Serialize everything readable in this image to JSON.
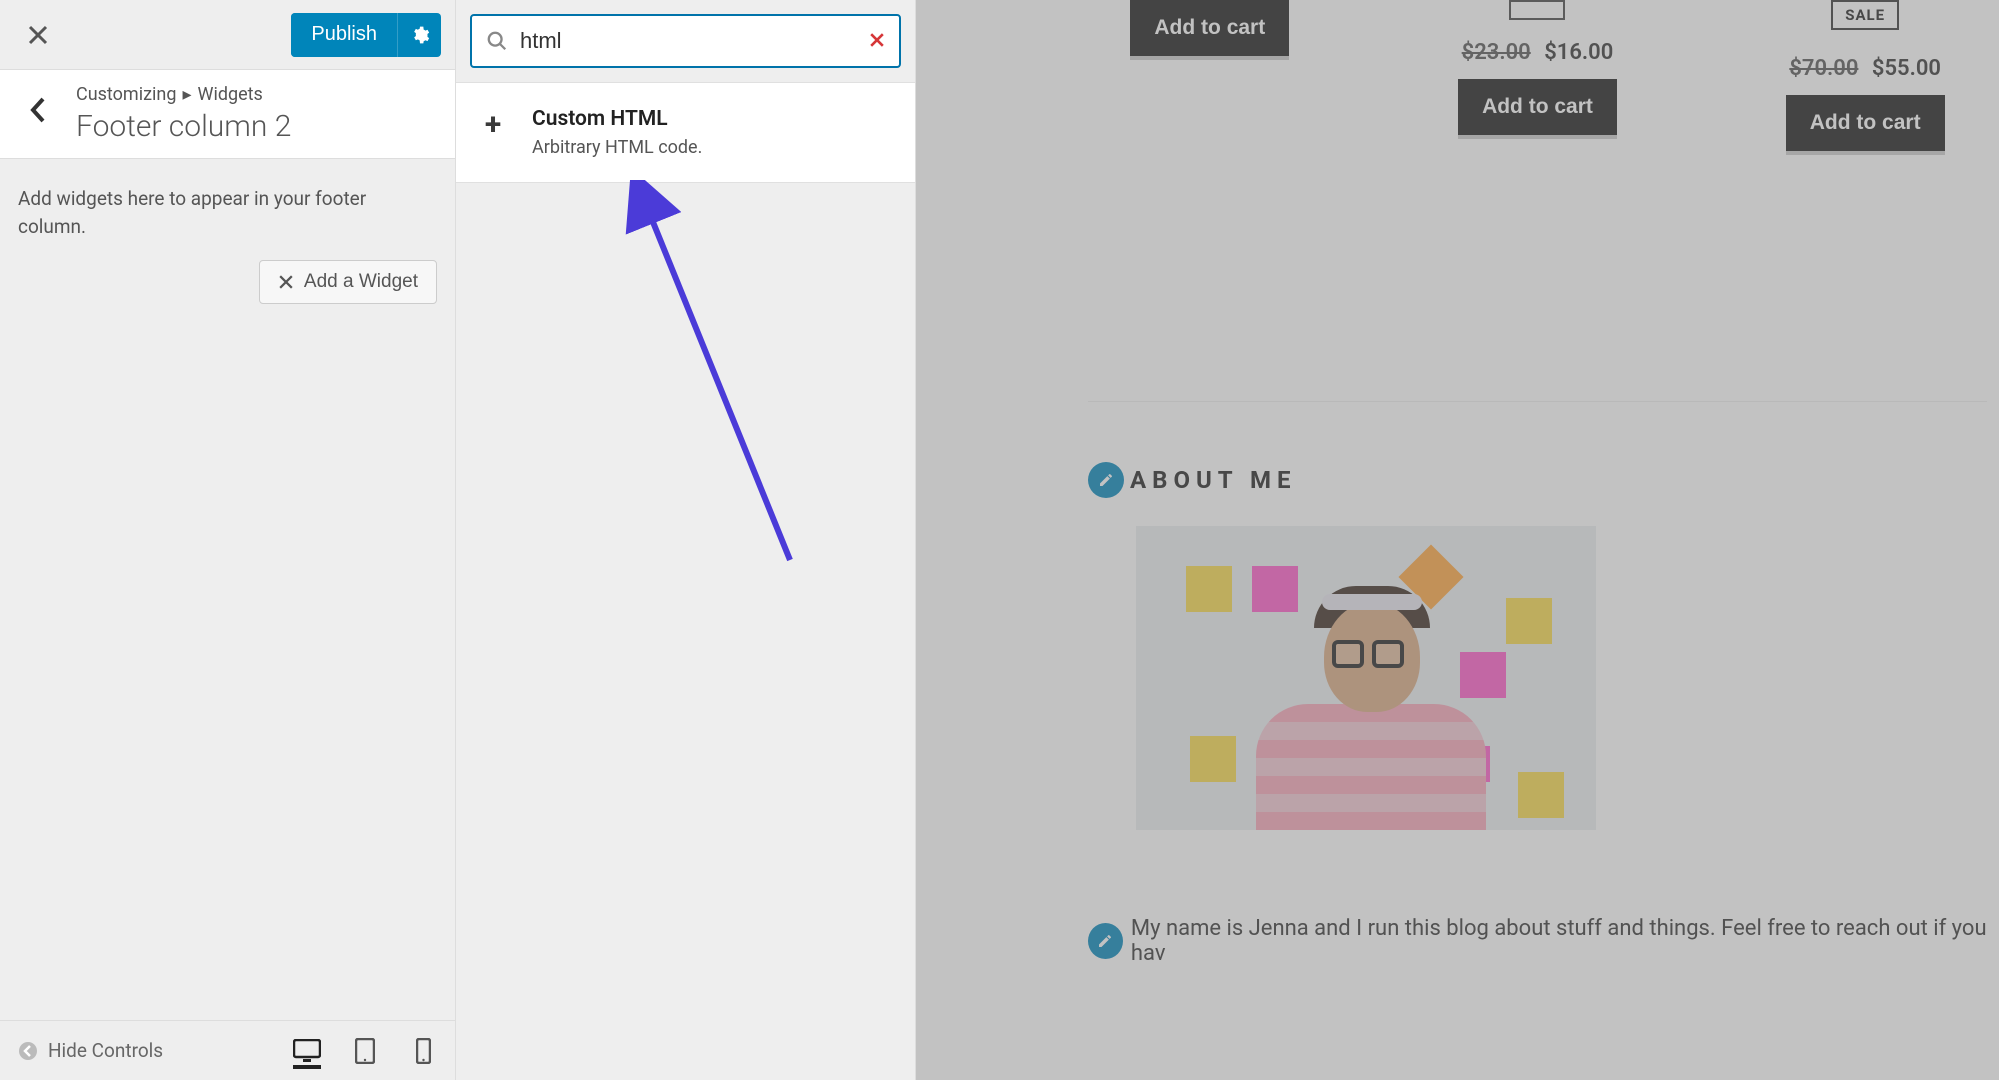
{
  "header": {
    "publish_label": "Publish"
  },
  "breadcrumb": {
    "root": "Customizing",
    "separator": "▸",
    "section": "Widgets"
  },
  "panel": {
    "title": "Footer column 2",
    "description": "Add widgets here to appear in your footer column.",
    "add_widget_label": "Add a Widget"
  },
  "footer_bar": {
    "hide_controls": "Hide Controls"
  },
  "widget_search": {
    "query": "html",
    "result_title": "Custom HTML",
    "result_desc": "Arbitrary HTML code."
  },
  "preview": {
    "products": [
      {
        "cart_label": "Add to cart"
      },
      {
        "old_price": "$23.00",
        "new_price": "$16.00",
        "cart_label": "Add to cart"
      },
      {
        "sale_label": "SALE",
        "old_price": "$70.00",
        "new_price": "$55.00",
        "cart_label": "Add to cart"
      }
    ],
    "about_heading": "ABOUT ME",
    "about_text": "My name is Jenna and I run this blog about stuff and things. Feel free to reach out if you hav"
  }
}
